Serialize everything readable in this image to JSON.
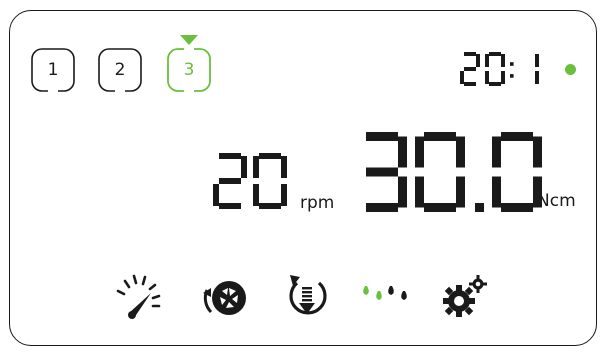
{
  "programs": [
    {
      "label": "1",
      "active": false
    },
    {
      "label": "2",
      "active": false
    },
    {
      "label": "3",
      "active": true
    }
  ],
  "clock": {
    "value": "20:1",
    "status_color": "#6cbf3e"
  },
  "speed": {
    "value": "20",
    "unit": "rpm"
  },
  "torque": {
    "value": "30.0",
    "unit": "Ncm"
  },
  "icons": [
    "speedometer-icon",
    "rotation-mode-icon",
    "auto-reverse-icon",
    "irrigation-icon",
    "settings-gears-icon"
  ],
  "colors": {
    "accent": "#6cbf3e",
    "ink": "#1a1a1a"
  }
}
